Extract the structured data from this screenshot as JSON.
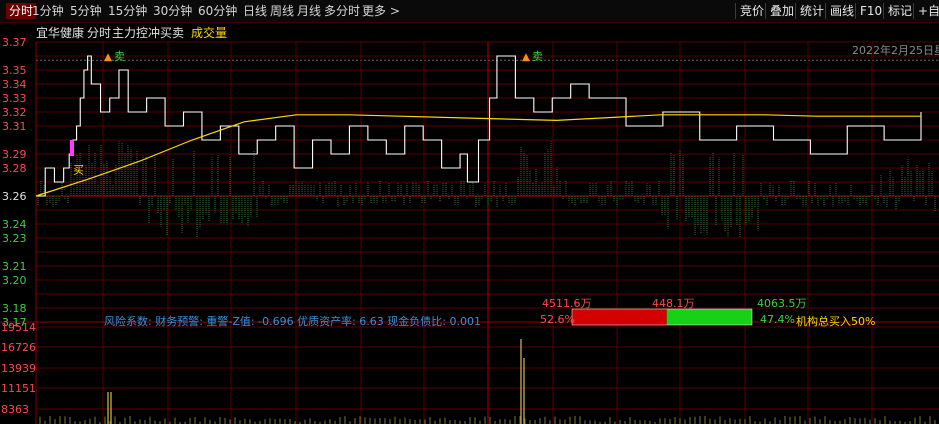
{
  "toolbar": {
    "periods": [
      "分时",
      "1分钟",
      "5分钟",
      "15分钟",
      "30分钟",
      "60分钟",
      "日线",
      "周线",
      "月线",
      "多分时",
      "更多 >"
    ],
    "active": "分时",
    "right_buttons": [
      "竞价",
      "叠加",
      "统计",
      "画线",
      "F10",
      "标记",
      "+自"
    ]
  },
  "infobar": {
    "stock_name": "宜华健康",
    "view": "分时",
    "indicator": "主力控冲买卖",
    "volume_label": "成交量",
    "date": "2022年2月25日星"
  },
  "price_axis": {
    "ticks": [
      "3.37",
      "3.36",
      "3.35",
      "3.34",
      "3.33",
      "3.32",
      "3.31",
      "3.30",
      "3.29",
      "3.28",
      "3.27",
      "3.26",
      "3.25",
      "3.24",
      "3.23",
      "3.22",
      "3.21",
      "3.20",
      "3.19",
      "3.18",
      "3.17"
    ],
    "labels": [
      "3.37",
      "3.35",
      "3.34",
      "3.33",
      "3.32",
      "3.31",
      "3.29",
      "3.28",
      "3.26",
      "3.24",
      "3.23",
      "3.21",
      "3.20",
      "3.18",
      "3.17"
    ],
    "base_price": "3.26"
  },
  "volume_axis": {
    "labels": [
      "19514",
      "16726",
      "13939",
      "11151",
      "8363"
    ]
  },
  "risk": {
    "text": "风险系数: 财务预警: 重警-Z值: -0.696 优质资产率: 6.63 现金负债比: 0.001"
  },
  "order_flow": {
    "sell_amount": "4511.6万",
    "mid_amount": "448.1万",
    "buy_amount": "4063.5万",
    "sell_pct": "52.6%",
    "buy_pct": "47.4%",
    "inst_label": "机构总买入50%",
    "sell_fraction": 0.526,
    "buy_fraction": 0.474
  },
  "markers": {
    "sell_label": "卖",
    "small_label": "买"
  },
  "colors": {
    "up": "#ff4a4a",
    "down": "#3ed03e",
    "price_line": "#ffffff",
    "avg_line": "#ffd800",
    "grid": "#5a0000"
  },
  "chart_data": {
    "type": "line",
    "title": "宜华健康 分时",
    "ylim": [
      3.17,
      3.37
    ],
    "series": [
      {
        "name": "price",
        "x_minutes": [
          0,
          5,
          10,
          15,
          18,
          20,
          22,
          24,
          26,
          28,
          30,
          35,
          40,
          45,
          50,
          60,
          70,
          80,
          90,
          100,
          110,
          120,
          130,
          140,
          150,
          160,
          170,
          180,
          190,
          200,
          210,
          220,
          230,
          234,
          240,
          246,
          250,
          260,
          270,
          280,
          290,
          300,
          320,
          340,
          360,
          380,
          400,
          420,
          440,
          460,
          480
        ],
        "values": [
          3.26,
          3.28,
          3.27,
          3.28,
          3.29,
          3.3,
          3.31,
          3.33,
          3.35,
          3.36,
          3.34,
          3.32,
          3.33,
          3.35,
          3.32,
          3.33,
          3.31,
          3.32,
          3.3,
          3.31,
          3.29,
          3.3,
          3.31,
          3.28,
          3.3,
          3.29,
          3.31,
          3.3,
          3.29,
          3.31,
          3.3,
          3.28,
          3.29,
          3.27,
          3.3,
          3.33,
          3.36,
          3.33,
          3.32,
          3.33,
          3.34,
          3.33,
          3.31,
          3.32,
          3.3,
          3.31,
          3.3,
          3.29,
          3.31,
          3.3,
          3.32
        ]
      },
      {
        "name": "avg",
        "values": [
          3.26,
          3.272,
          3.285,
          3.3,
          3.313,
          3.318,
          3.318,
          3.317,
          3.316,
          3.315,
          3.314,
          3.316,
          3.318,
          3.318,
          3.318,
          3.317,
          3.317,
          3.317
        ]
      }
    ]
  }
}
